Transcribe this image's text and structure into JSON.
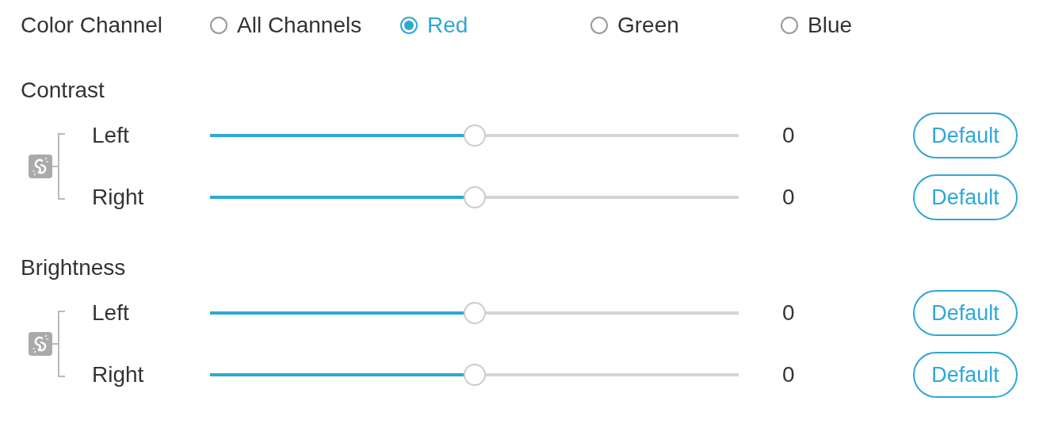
{
  "color_channel": {
    "label": "Color Channel",
    "options": [
      {
        "label": "All Channels",
        "selected": false
      },
      {
        "label": "Red",
        "selected": true
      },
      {
        "label": "Green",
        "selected": false
      },
      {
        "label": "Blue",
        "selected": false
      }
    ]
  },
  "sections": [
    {
      "title": "Contrast",
      "linked": false,
      "rows": [
        {
          "label": "Left",
          "level": 0.5,
          "value": "0",
          "button": "Default"
        },
        {
          "label": "Right",
          "level": 0.5,
          "value": "0",
          "button": "Default"
        }
      ]
    },
    {
      "title": "Brightness",
      "linked": false,
      "rows": [
        {
          "label": "Left",
          "level": 0.5,
          "value": "0",
          "button": "Default"
        },
        {
          "label": "Right",
          "level": 0.5,
          "value": "0",
          "button": "Default"
        }
      ]
    }
  ]
}
